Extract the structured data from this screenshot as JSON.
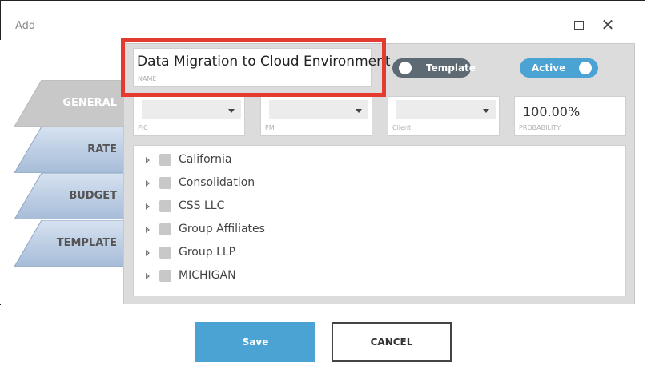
{
  "window": {
    "title": "Add"
  },
  "tabs": [
    {
      "label": "GENERAL",
      "active": true
    },
    {
      "label": "RATE",
      "active": false
    },
    {
      "label": "BUDGET",
      "active": false
    },
    {
      "label": "TEMPLATE",
      "active": false
    }
  ],
  "name": {
    "value": "Data Migration to Cloud Environment",
    "label": "NAME"
  },
  "toggles": {
    "template": {
      "label": "Template",
      "on": false
    },
    "active": {
      "label": "Active",
      "on": true
    }
  },
  "fields": {
    "pic": {
      "label": "PIC",
      "value": ""
    },
    "pm": {
      "label": "PM",
      "value": ""
    },
    "client": {
      "label": "Client",
      "value": ""
    },
    "probability": {
      "label": "PROBABILITY",
      "value": "100.00%"
    }
  },
  "tree": [
    "California",
    "Consolidation",
    "CSS LLC",
    "Group Affiliates",
    "Group LLP",
    "MICHIGAN"
  ],
  "buttons": {
    "save": "Save",
    "cancel": "CANCEL"
  },
  "colors": {
    "accent": "#4aa3d3",
    "highlight": "#e53a2f",
    "tab_active": "#c8c8c8",
    "tab_inactive": "#b3c6de"
  }
}
